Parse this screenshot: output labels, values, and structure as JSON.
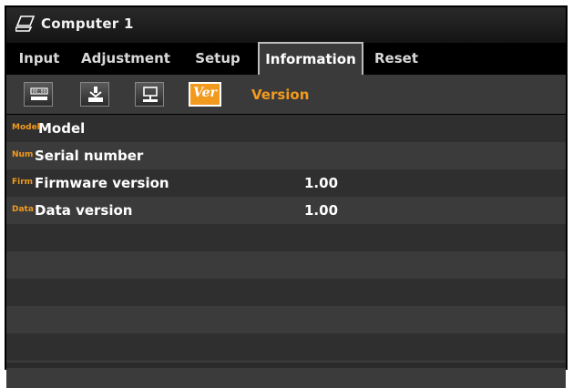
{
  "title": {
    "text": "Computer 1",
    "icon": "computer-icon"
  },
  "tabs": [
    {
      "label": "Input"
    },
    {
      "label": "Adjustment"
    },
    {
      "label": "Setup"
    },
    {
      "label": "Information",
      "active": true
    },
    {
      "label": "Reset"
    }
  ],
  "subtabs": {
    "icons": [
      "usage-time-icon",
      "source-icon",
      "wired-lan-icon",
      "version-icon"
    ],
    "active_text": "Ver",
    "label": "Version"
  },
  "rows": [
    {
      "abbr": "Model",
      "label": "Model",
      "value": ""
    },
    {
      "abbr": "Num",
      "label": "Serial number",
      "value": ""
    },
    {
      "abbr": "Firm",
      "label": "Firmware version",
      "value": "1.00"
    },
    {
      "abbr": "Data",
      "label": "Data version",
      "value": "1.00"
    }
  ],
  "colors": {
    "accent": "#f29a1d",
    "background": "#000000"
  }
}
